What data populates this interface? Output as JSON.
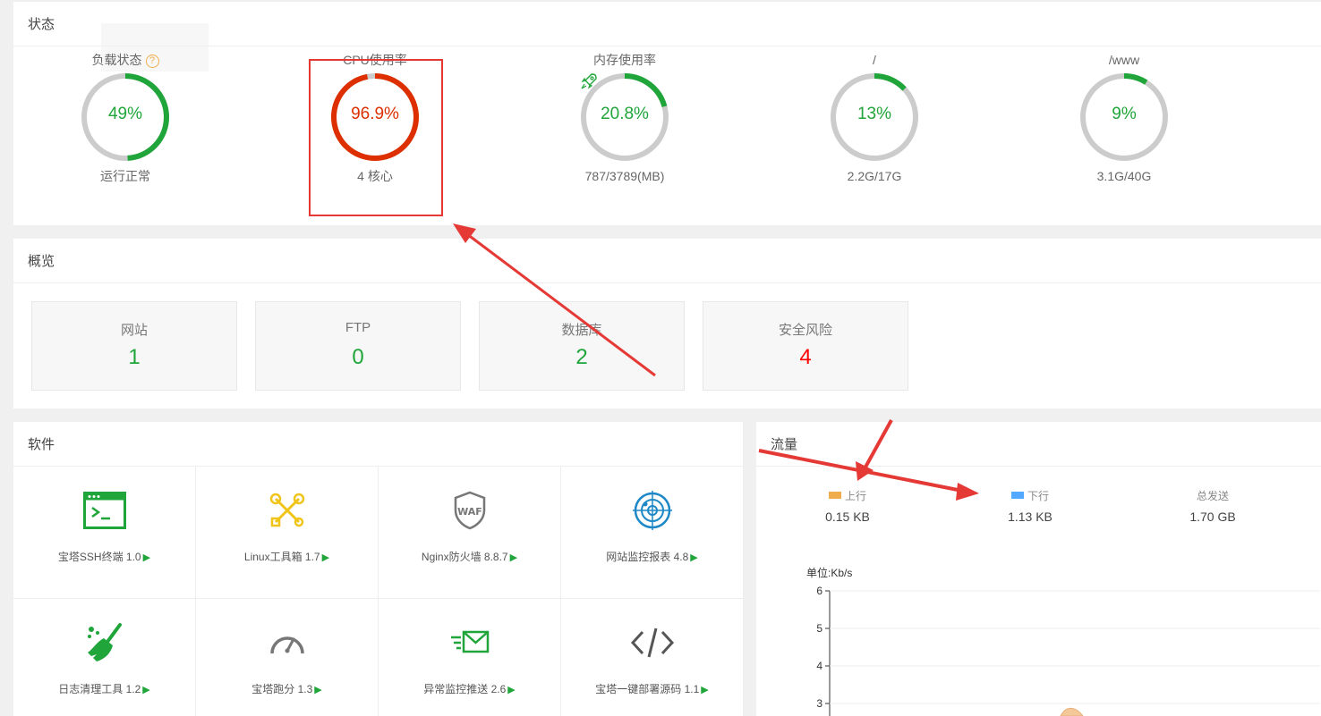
{
  "status": {
    "title": "状态",
    "gauges": [
      {
        "label": "负载状态",
        "value": "49%",
        "percent": 49,
        "sub": "运行正常",
        "color": "#20a53a",
        "help": "?"
      },
      {
        "label": "CPU使用率",
        "value": "96.9%",
        "percent": 96.9,
        "sub": "4 核心",
        "color": "#dd2f00"
      },
      {
        "label": "内存使用率",
        "value": "20.8%",
        "percent": 20.8,
        "sub": "787/3789(MB)",
        "color": "#20a53a",
        "icon": "rocket-icon"
      },
      {
        "label": "/",
        "value": "13%",
        "percent": 13,
        "sub": "2.2G/17G",
        "color": "#20a53a"
      },
      {
        "label": "/www",
        "value": "9%",
        "percent": 9,
        "sub": "3.1G/40G",
        "color": "#20a53a"
      }
    ]
  },
  "overview": {
    "title": "概览",
    "cards": [
      {
        "label": "网站",
        "value": "1",
        "color": "#20a53a"
      },
      {
        "label": "FTP",
        "value": "0",
        "color": "#20a53a"
      },
      {
        "label": "数据库",
        "value": "2",
        "color": "#20a53a"
      },
      {
        "label": "安全风险",
        "value": "4",
        "color": "#ff0000"
      }
    ]
  },
  "software": {
    "title": "软件",
    "items": [
      {
        "name": "宝塔SSH终端 1.0",
        "icon": "terminal-icon"
      },
      {
        "name": "Linux工具箱 1.7",
        "icon": "toolbox-icon"
      },
      {
        "name": "Nginx防火墙 8.8.7",
        "icon": "waf-shield-icon",
        "icon_text": "WAF"
      },
      {
        "name": "网站监控报表 4.8",
        "icon": "radar-icon"
      },
      {
        "name": "日志清理工具 1.2",
        "icon": "broom-icon"
      },
      {
        "name": "宝塔跑分 1.3",
        "icon": "speedometer-icon"
      },
      {
        "name": "异常监控推送 2.6",
        "icon": "mail-send-icon"
      },
      {
        "name": "宝塔一键部署源码 1.1",
        "icon": "code-icon"
      }
    ],
    "arrow": "▶"
  },
  "traffic": {
    "title": "流量",
    "stats": [
      {
        "label": "上行",
        "value": "0.15 KB",
        "swatch": "#f0ad4e"
      },
      {
        "label": "下行",
        "value": "1.13 KB",
        "swatch": "#52a9ff"
      },
      {
        "label": "总发送",
        "value": "1.70 GB"
      }
    ],
    "unit": "单位:Kb/s"
  },
  "chart_data": {
    "type": "area",
    "title": "",
    "xlabel": "",
    "ylabel": "单位:Kb/s",
    "ylim": [
      2.8,
      6
    ],
    "yticks": [
      6,
      5,
      4,
      3
    ],
    "series": [
      {
        "values": []
      }
    ]
  },
  "colors": {
    "accent": "#20a53a",
    "danger": "#dd2f00",
    "annotation": "#e53935"
  }
}
